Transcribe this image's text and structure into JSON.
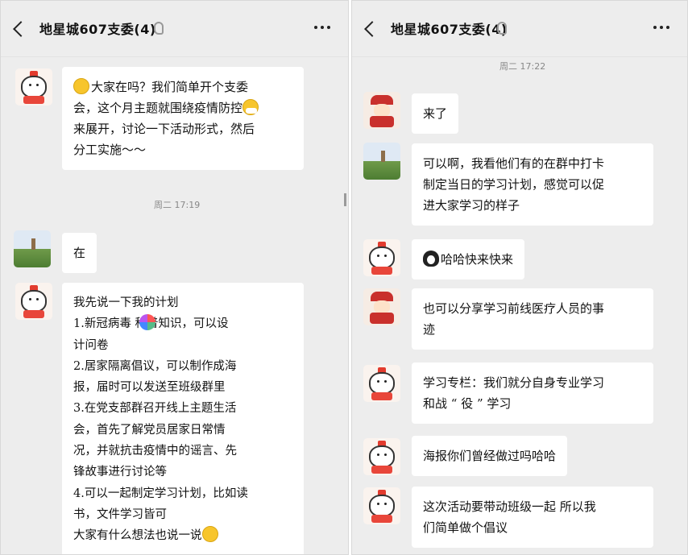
{
  "left_panel": {
    "title": "地星城607支委(4)",
    "messages": [
      {
        "lines": [
          "大家在吗？我们简单开个支委",
          "会，这个月主题就围绕疫情防控",
          "来展开，讨论一下活动形式，然后",
          "分工实施～～"
        ]
      },
      {
        "time": "周二 17:19"
      },
      {
        "lines": [
          "在"
        ]
      },
      {
        "lines": [
          "我先说一下我的计划",
          "1.新冠病毒  科普知识，可以设",
          "计问卷",
          "2.居家隔离倡议，可以制作成海",
          "报，届时可以发送至班级群里",
          "3.在党支部群召开线上主题生活",
          "会，首先了解党员居家日常情",
          "况，并就抗击疫情中的谣言、先",
          "锋故事进行讨论等",
          "4.可以一起制定学习计划，比如读",
          "书，文件学习皆可",
          "大家有什么想法也说一说"
        ]
      }
    ]
  },
  "right_panel": {
    "title": "地星城607支委(4)",
    "messages": [
      {
        "time": "周二 17:22"
      },
      {
        "lines": [
          "来了"
        ]
      },
      {
        "lines": [
          "可以啊，我看他们有的在群中打卡",
          "制定当日的学习计划，感觉可以促",
          "进大家学习的样子"
        ]
      },
      {
        "lines": [
          "哈哈快来快来"
        ]
      },
      {
        "lines": [
          "也可以分享学习前线医疗人员的事",
          "迹"
        ]
      },
      {
        "lines": [
          "学习专栏：我们就分自身专业学习",
          "和战 “ 役 ” 学习"
        ]
      },
      {
        "lines": [
          "海报你们曾经做过吗哈哈"
        ]
      },
      {
        "lines": [
          "这次活动要带动班级一起  所以我",
          "们简单做个倡议"
        ]
      }
    ]
  },
  "icons": {
    "back": "chevron-left-icon",
    "mute": "ear-icon",
    "more": "more-dots-icon"
  },
  "colors": {
    "chat_background": "#ededed",
    "bubble": "#ffffff",
    "timestamp": "#888888"
  }
}
